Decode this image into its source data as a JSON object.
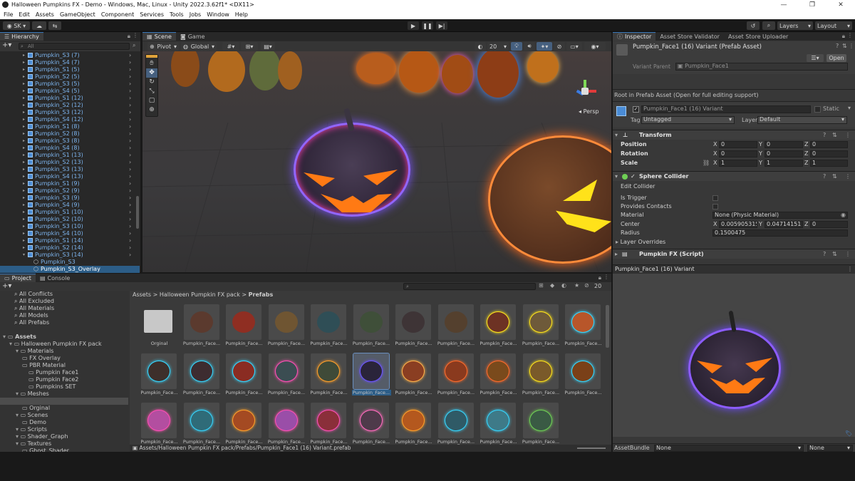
{
  "window": {
    "title": "Halloween Pumpkins FX - Demo - Windows, Mac, Linux - Unity 2022.3.62f1* <DX11>"
  },
  "menu": [
    "File",
    "Edit",
    "Assets",
    "GameObject",
    "Component",
    "Services",
    "Tools",
    "Jobs",
    "Window",
    "Help"
  ],
  "toolbar": {
    "account": "SK",
    "layers": "Layers",
    "layout": "Layout"
  },
  "hierarchy": {
    "tab": "Hierarchy",
    "search_placeholder": "All",
    "items": [
      "Pumpkin_S3 (7)",
      "Pumpkin_S4 (7)",
      "Pumpkin_S1 (5)",
      "Pumpkin_S2 (5)",
      "Pumpkin_S3 (5)",
      "Pumpkin_S4 (5)",
      "Pumpkin_S1 (12)",
      "Pumpkin_S2 (12)",
      "Pumpkin_S3 (12)",
      "Pumpkin_S4 (12)",
      "Pumpkin_S1 (8)",
      "Pumpkin_S2 (8)",
      "Pumpkin_S3 (8)",
      "Pumpkin_S4 (8)",
      "Pumpkin_S1 (13)",
      "Pumpkin_S2 (13)",
      "Pumpkin_S3 (13)",
      "Pumpkin_S4 (13)",
      "Pumpkin_S1 (9)",
      "Pumpkin_S2 (9)",
      "Pumpkin_S3 (9)",
      "Pumpkin_S4 (9)",
      "Pumpkin_S1 (10)",
      "Pumpkin_S2 (10)",
      "Pumpkin_S3 (10)",
      "Pumpkin_S4 (10)",
      "Pumpkin_S1 (14)",
      "Pumpkin_S2 (14)",
      "Pumpkin_S3 (14)"
    ],
    "children": [
      "Pumpkin_S3",
      "Pumpkin_S3_Overlay"
    ]
  },
  "scene": {
    "tabs": [
      "Scene",
      "Game"
    ],
    "pivot": "Pivot",
    "global": "Global",
    "count": "20",
    "persp": "Persp"
  },
  "inspector": {
    "tabs": [
      "Inspector",
      "Asset Store Validator",
      "Asset Store Uploader"
    ],
    "asset_title": "Pumpkin_Face1 (16) Variant (Prefab Asset)",
    "open": "Open",
    "variant_parent_label": "Variant Parent",
    "variant_parent": "Pumpkin_Face1",
    "root_note": "Root in Prefab Asset (Open for full editing support)",
    "object_name": "Pumpkin_Face1 (16) Variant",
    "static": "Static",
    "tag_label": "Tag",
    "tag": "Untagged",
    "layer_label": "Layer",
    "layer": "Default",
    "transform": {
      "title": "Transform",
      "position_label": "Position",
      "position": [
        "0",
        "0",
        "0"
      ],
      "rotation_label": "Rotation",
      "rotation": [
        "0",
        "0",
        "0"
      ],
      "scale_label": "Scale",
      "scale": [
        "1",
        "1",
        "1"
      ]
    },
    "collider": {
      "title": "Sphere Collider",
      "edit": "Edit Collider",
      "is_trigger": "Is Trigger",
      "provides_contacts": "Provides Contacts",
      "material_label": "Material",
      "material": "None (Physic Material)",
      "center_label": "Center",
      "center": [
        "0.005905315",
        "0.04714151",
        "0"
      ],
      "radius_label": "Radius",
      "radius": "0.1500475",
      "layer_overrides": "Layer Overrides"
    },
    "script": {
      "title": "Pumpkin FX (Script)"
    },
    "preview_title": "Pumpkin_Face1 (16) Variant",
    "assetbundle_label": "AssetBundle",
    "assetbundle": "None",
    "assetbundle_variant": "None"
  },
  "project": {
    "tabs": [
      "Project",
      "Console"
    ],
    "favorites": [
      "All Conflicts",
      "All Excluded",
      "All Materials",
      "All Models",
      "All Prefabs"
    ],
    "tree": [
      {
        "label": "Assets",
        "indent": 0
      },
      {
        "label": "Halloween Pumpkin FX pack",
        "indent": 1
      },
      {
        "label": "Materials",
        "indent": 2
      },
      {
        "label": "FX Overlay",
        "indent": 3
      },
      {
        "label": "PBR Material",
        "indent": 3
      },
      {
        "label": "Pumpkin Face1",
        "indent": 4
      },
      {
        "label": "Pumpkin Face2",
        "indent": 4
      },
      {
        "label": "Pumpkins SET",
        "indent": 4
      },
      {
        "label": "Meshes",
        "indent": 2
      },
      {
        "label": "Prefabs",
        "indent": 2
      },
      {
        "label": "Orginal",
        "indent": 3
      },
      {
        "label": "Scenes",
        "indent": 2
      },
      {
        "label": "Demo",
        "indent": 3
      },
      {
        "label": "Scripts",
        "indent": 2
      },
      {
        "label": "Shader_Graph",
        "indent": 2
      },
      {
        "label": "Textures",
        "indent": 2
      },
      {
        "label": "Ghost_Shader",
        "indent": 3
      }
    ],
    "breadcrumb": [
      "Assets",
      "Halloween Pumpkin FX pack",
      "Prefabs"
    ],
    "count": "20",
    "folder_label": "Orginal",
    "asset_label": "Pumpkin_Face...",
    "status_path": "Assets/Halloween Pumpkin FX pack/Prefabs/Pumpkin_Face1 (16) Variant.prefab"
  },
  "colors": {
    "accent": "#3a79bb",
    "hierarchy_text": "#7db5ef",
    "bg_dark": "#191919"
  }
}
